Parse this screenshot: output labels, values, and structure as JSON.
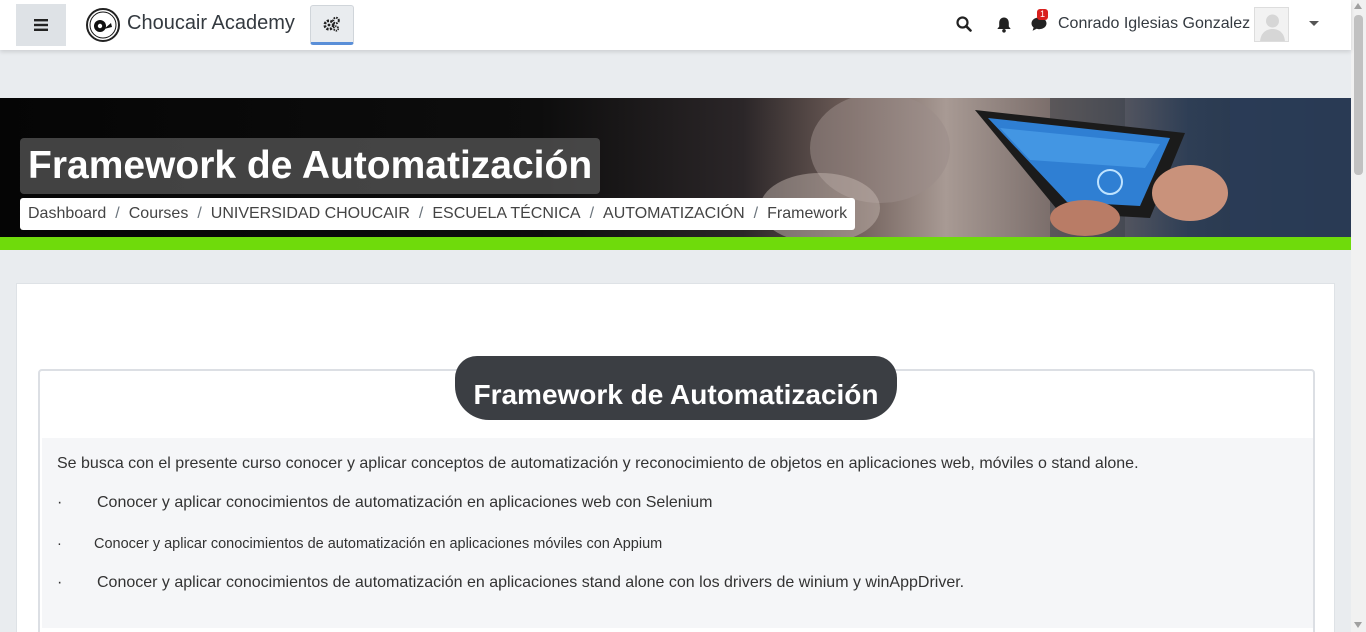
{
  "navbar": {
    "brand": "Choucair Academy",
    "username": "Conrado Iglesias Gonzalez",
    "message_badge": "1",
    "icons": [
      "menu-icon",
      "logo",
      "settings-cog-icon",
      "search-icon",
      "bell-icon",
      "chat-icon",
      "user-avatar",
      "caret-down-icon"
    ]
  },
  "banner": {
    "title": "Framework de Automatización",
    "accent_color": "#6fdb0b",
    "breadcrumb": [
      "Dashboard",
      "Courses",
      "UNIVERSIDAD CHOUCAIR",
      "ESCUELA TÉCNICA",
      "AUTOMATIZACIÓN",
      "Framework"
    ],
    "separator": "/"
  },
  "content": {
    "heading": "Framework de Automatización",
    "intro": "Se busca con el presente curso conocer y aplicar conceptos de automatización y reconocimiento de objetos en aplicaciones web, móviles o stand alone.",
    "bullet_symbol": "·",
    "bullets": [
      "Conocer y aplicar conocimientos de automatización en aplicaciones web con Selenium",
      "Conocer y aplicar conocimientos de automatización en aplicaciones móviles con Appium",
      "Conocer y aplicar conocimientos de automatización en aplicaciones stand alone con los drivers de winium y winAppDriver."
    ]
  }
}
